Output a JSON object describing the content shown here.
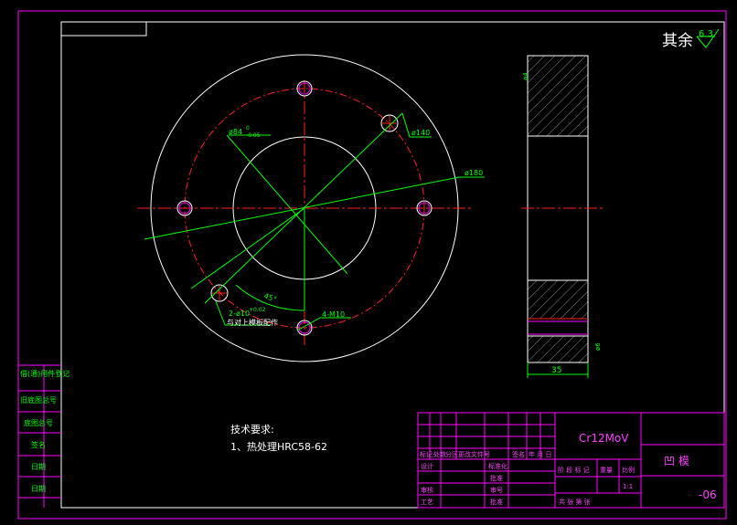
{
  "colors": {
    "background": "#000000",
    "frame": "#ff00ff",
    "outline": "#ffffff",
    "centerline": "#ff2020",
    "leader": "#00ff00",
    "hatch": "#888888",
    "title_text_magenta": "#ff40ff",
    "title_text_green": "#00ff00"
  },
  "roughness": {
    "label": "其余",
    "value": "6.3"
  },
  "dimensions": {
    "bore": "ø84",
    "bore_tol_upper": "0",
    "bore_tol_lower": "-0.05",
    "pitch_circle": "ø140",
    "outer": "ø180",
    "pin_holes": "2-ø10",
    "pin_tol": "+0.02",
    "pin_note": "与对上模板配作",
    "angle": "45°",
    "thread": "4-M10",
    "thickness": "35",
    "side_small_top": "ø4",
    "side_small_bottom": "ø6"
  },
  "tech_requirements": {
    "title": "技术要求:",
    "items": [
      "1、热处理HRC58-62"
    ]
  },
  "side_labels": [
    "借(通)用件登记",
    "旧底图总号",
    "底图总号",
    "签名",
    "日期",
    "日期"
  ],
  "title_block": {
    "material": "Cr12MoV",
    "part_name": "凹 模",
    "drawing_no": "-06",
    "revision_header": [
      "标记",
      "处数",
      "分区",
      "更改文件号",
      "签名",
      "年 月 日"
    ],
    "rows_left": [
      "设计",
      "审核",
      "工艺"
    ],
    "rows_mid": [
      "标准化",
      "批准",
      "审号",
      "批准"
    ],
    "stage_header": [
      "阶 段 标 记",
      "重量",
      "比例"
    ],
    "scale": "1:1",
    "sheet": "共  张  第  张"
  }
}
